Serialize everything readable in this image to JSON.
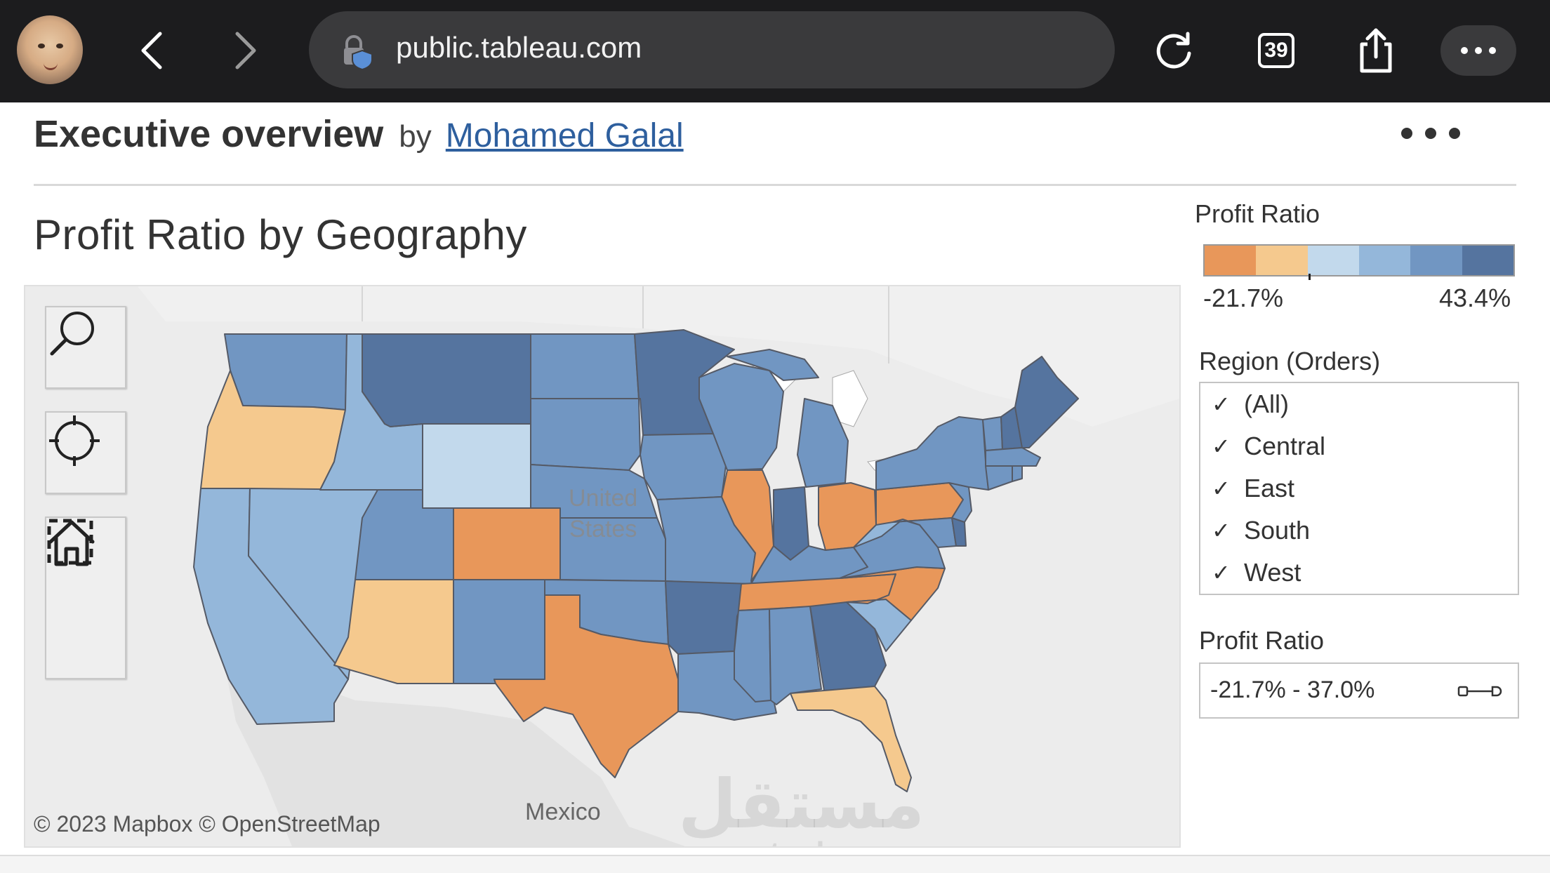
{
  "browser": {
    "url": "public.tableau.com",
    "tab_count": "39"
  },
  "header": {
    "title": "Executive overview",
    "by": "by",
    "author": "Mohamed Galal"
  },
  "chart": {
    "title": "Profit Ratio by Geography",
    "us_label_line1": "United",
    "us_label_line2": "States",
    "mexico_label": "Mexico",
    "attribution": "© 2023 Mapbox  © OpenStreetMap"
  },
  "watermark": {
    "arabic": "مستقل",
    "latin": "mostaql.com"
  },
  "legend": {
    "title": "Profit Ratio",
    "min": "-21.7%",
    "max": "43.4%",
    "colors": [
      "#e8975a",
      "#f5c98e",
      "#c2d9ec",
      "#94b7da",
      "#7196c2",
      "#55749f"
    ]
  },
  "region_filter": {
    "title": "Region (Orders)",
    "items": [
      "(All)",
      "Central",
      "East",
      "South",
      "West"
    ]
  },
  "profit_filter": {
    "title": "Profit Ratio",
    "value": "-21.7% - 37.0%"
  },
  "icons": {
    "search": "search-icon",
    "locate": "crosshair-icon",
    "select": "marquee-select-icon",
    "home": "home-icon"
  }
}
